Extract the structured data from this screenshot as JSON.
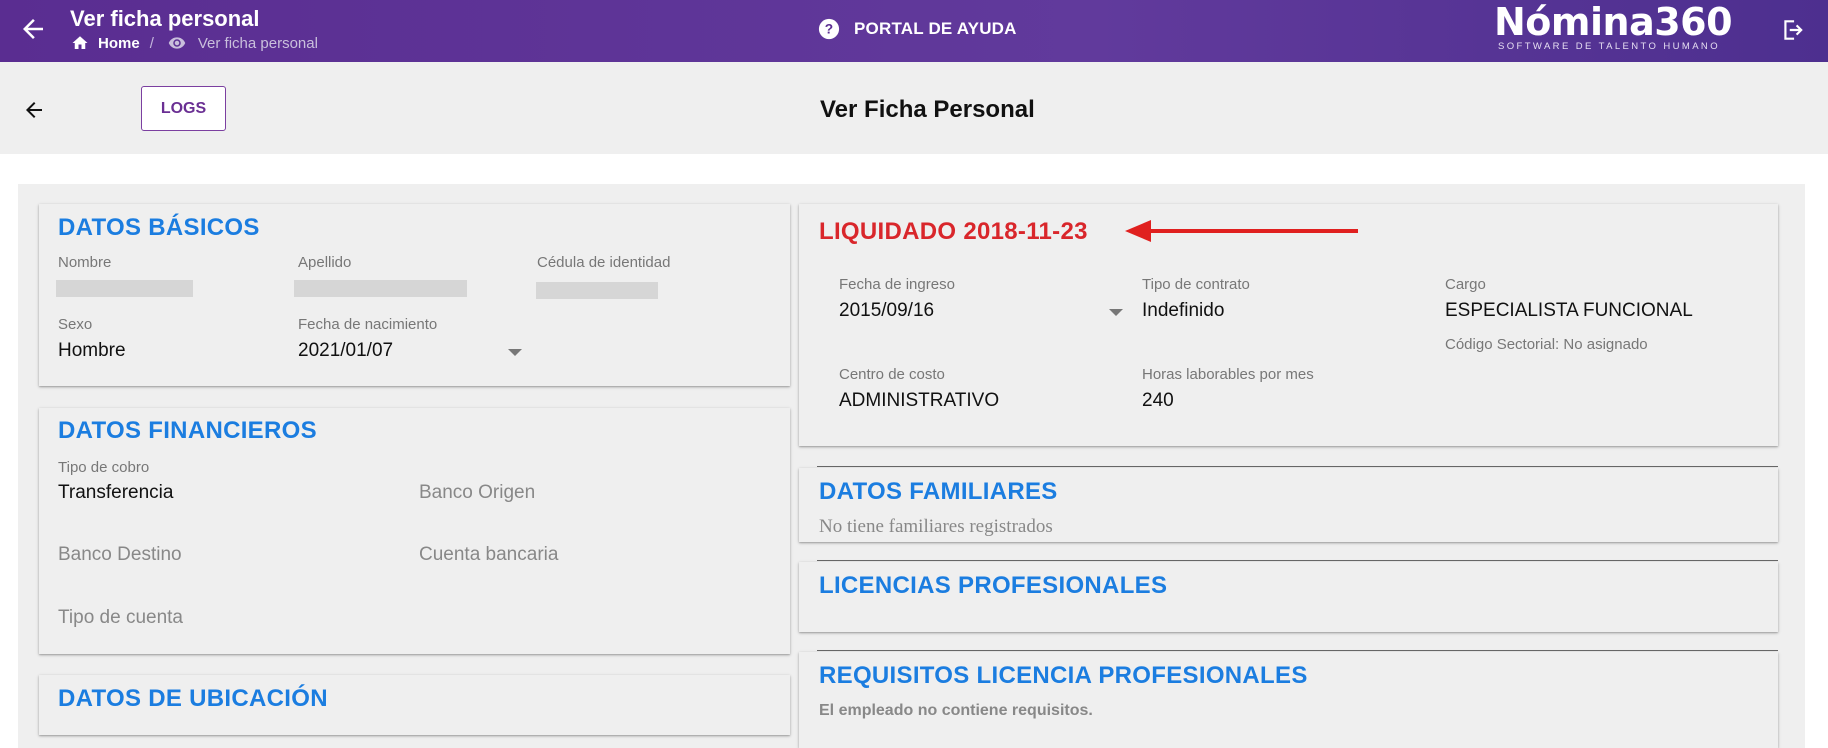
{
  "topbar": {
    "title": "Ver ficha personal",
    "breadcrumb_home": "Home",
    "breadcrumb_sep": "/",
    "breadcrumb_current": "Ver ficha personal",
    "help_label": "PORTAL DE AYUDA",
    "logo_brand": "Nómina360",
    "logo_tagline": "SOFTWARE DE TALENTO HUMANO"
  },
  "subheader": {
    "logs_label": "LOGS",
    "page_title": "Ver Ficha Personal"
  },
  "basicos": {
    "title": "DATOS BÁSICOS",
    "nombre_label": "Nombre",
    "apellido_label": "Apellido",
    "cedula_label": "Cédula de identidad",
    "sexo_label": "Sexo",
    "sexo_value": "Hombre",
    "nacimiento_label": "Fecha de nacimiento",
    "nacimiento_value": "2021/01/07"
  },
  "financieros": {
    "title": "DATOS FINANCIEROS",
    "tipo_cobro_label": "Tipo de cobro",
    "tipo_cobro_value": "Transferencia",
    "banco_origen": "Banco Origen",
    "banco_destino": "Banco Destino",
    "cuenta_bancaria": "Cuenta bancaria",
    "tipo_cuenta": "Tipo de cuenta"
  },
  "ubicacion": {
    "title": "DATOS DE UBICACIÓN"
  },
  "liquidado": {
    "title": "LIQUIDADO 2018-11-23",
    "ingreso_label": "Fecha de ingreso",
    "ingreso_value": "2015/09/16",
    "contrato_label": "Tipo de contrato",
    "contrato_value": "Indefinido",
    "cargo_label": "Cargo",
    "cargo_value": "ESPECIALISTA FUNCIONAL",
    "codigo_sectorial": "Código Sectorial: No asignado",
    "centro_label": "Centro de costo",
    "centro_value": "ADMINISTRATIVO",
    "horas_label": "Horas laborables por mes",
    "horas_value": "240"
  },
  "familiares": {
    "title": "DATOS FAMILIARES",
    "empty": "No tiene familiares registrados"
  },
  "licencias": {
    "title": "LICENCIAS PROFESIONALES"
  },
  "requisitos": {
    "title": "REQUISITOS LICENCIA PROFESIONALES",
    "empty": "El empleado no contiene requisitos."
  },
  "colors": {
    "topbar": "#5a2d91",
    "section_title": "#1b7de0",
    "liquidado": "#d9262b",
    "arrow": "#e0201f"
  }
}
